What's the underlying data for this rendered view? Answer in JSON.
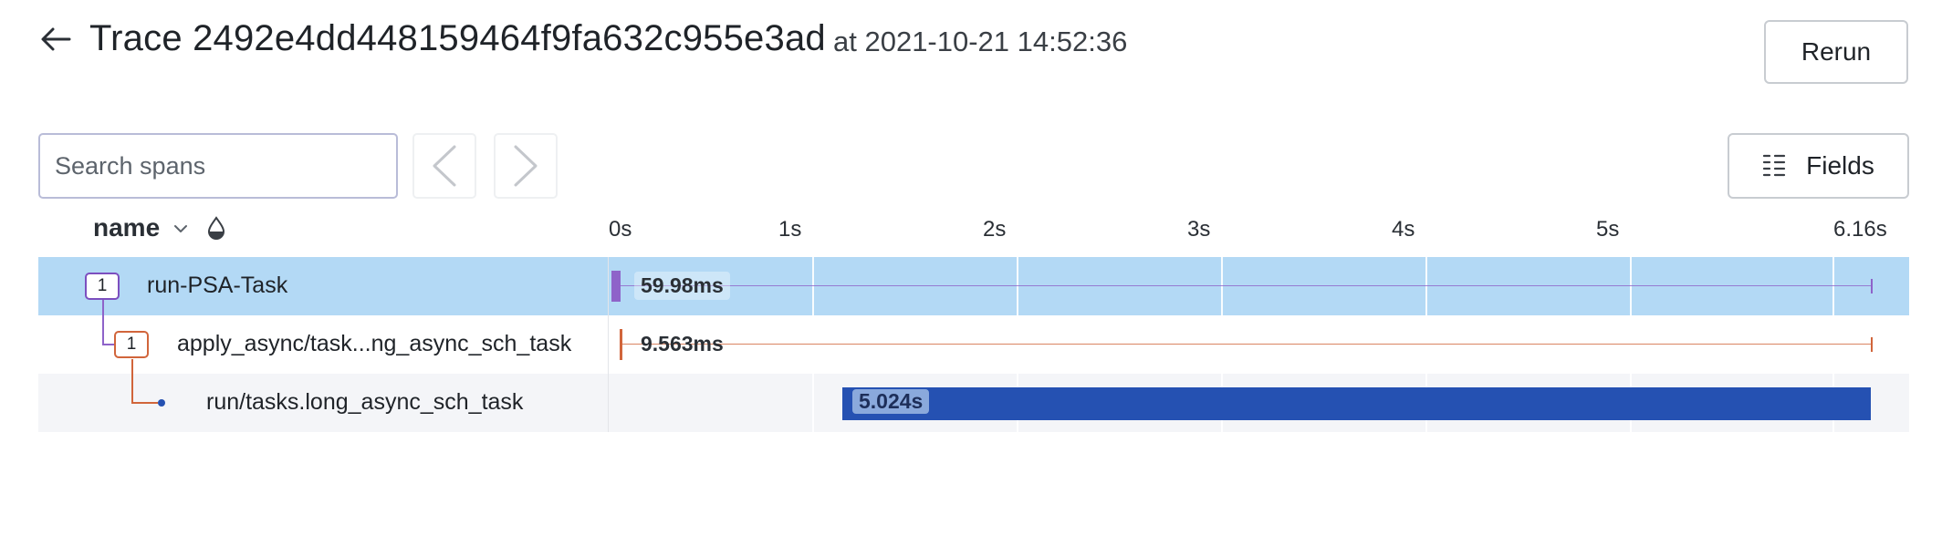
{
  "header": {
    "back_icon": "arrow-left-icon",
    "title": "Trace 2492e4dd448159464f9fa632c955e3ad",
    "subtitle": "at 2021-10-21 14:52:36",
    "rerun_label": "Rerun"
  },
  "toolbar": {
    "search_placeholder": "Search spans",
    "search_value": "",
    "prev_icon": "chevron-left-icon",
    "next_icon": "chevron-right-icon",
    "fields_icon": "columns-icon",
    "fields_label": "Fields"
  },
  "table": {
    "name_header": "name",
    "sort_icon": "chevron-down-icon",
    "color_icon": "color-drop-icon",
    "timeline_ticks": [
      "0s",
      "1s",
      "2s",
      "3s",
      "4s",
      "5s",
      "6.16s"
    ],
    "total_duration_s": 6.16,
    "rows": [
      {
        "badge": "1",
        "label": "run-PSA-Task",
        "duration": "59.98ms",
        "start_s": 0,
        "end_s": 6.16,
        "color": "#8e63c9",
        "selected": true
      },
      {
        "badge": "1",
        "label": "apply_async/task...ng_async_sch_task",
        "duration": "9.563ms",
        "start_s": 0.04,
        "end_s": 6.16,
        "color": "#d1653b",
        "selected": false
      },
      {
        "badge": "",
        "label": "run/tasks.long_async_sch_task",
        "duration": "5.024s",
        "start_s": 1.13,
        "end_s": 6.16,
        "color": "#2551b2",
        "selected": false
      }
    ]
  }
}
